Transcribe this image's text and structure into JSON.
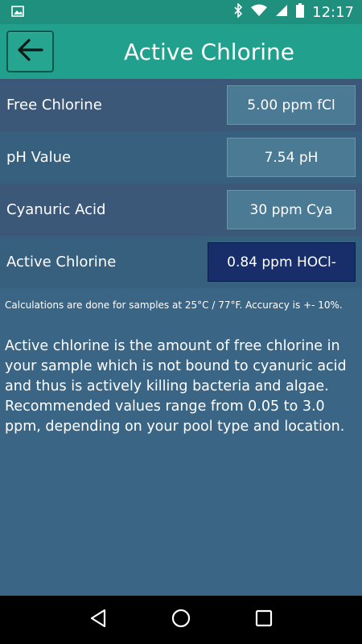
{
  "status_bar": {
    "time": "12:17",
    "icons": [
      "image-icon",
      "bluetooth-icon",
      "wifi-icon",
      "signal-icon",
      "battery-icon"
    ]
  },
  "header": {
    "title": "Active Chlorine",
    "back_icon": "arrow-left-icon"
  },
  "rows": [
    {
      "label": "Free Chlorine",
      "value": "5.00 ppm fCl"
    },
    {
      "label": "pH Value",
      "value": "7.54 pH"
    },
    {
      "label": "Cyanuric Acid",
      "value": "30 ppm Cya"
    },
    {
      "label": "Active Chlorine",
      "value": "0.84 ppm HOCl-"
    }
  ],
  "footnote": "Calculations are done for samples at 25°C / 77°F. Accuracy is +- 10%.",
  "description": "Active chlorine is the amount of free chlorine in your sample which is not bound to cyanuric acid and thus is actively killing bacteria and algae. Recommended values range from 0.05 to 3.0 ppm, depending on your pool type and location.",
  "nav_bar": {
    "icons": [
      "back-triangle-icon",
      "home-circle-icon",
      "recents-square-icon"
    ]
  },
  "colors": {
    "status_bar": "#1f8f7e",
    "app_bar": "#21a08e",
    "background": "#3a6584",
    "result_box": "#172e6a"
  }
}
